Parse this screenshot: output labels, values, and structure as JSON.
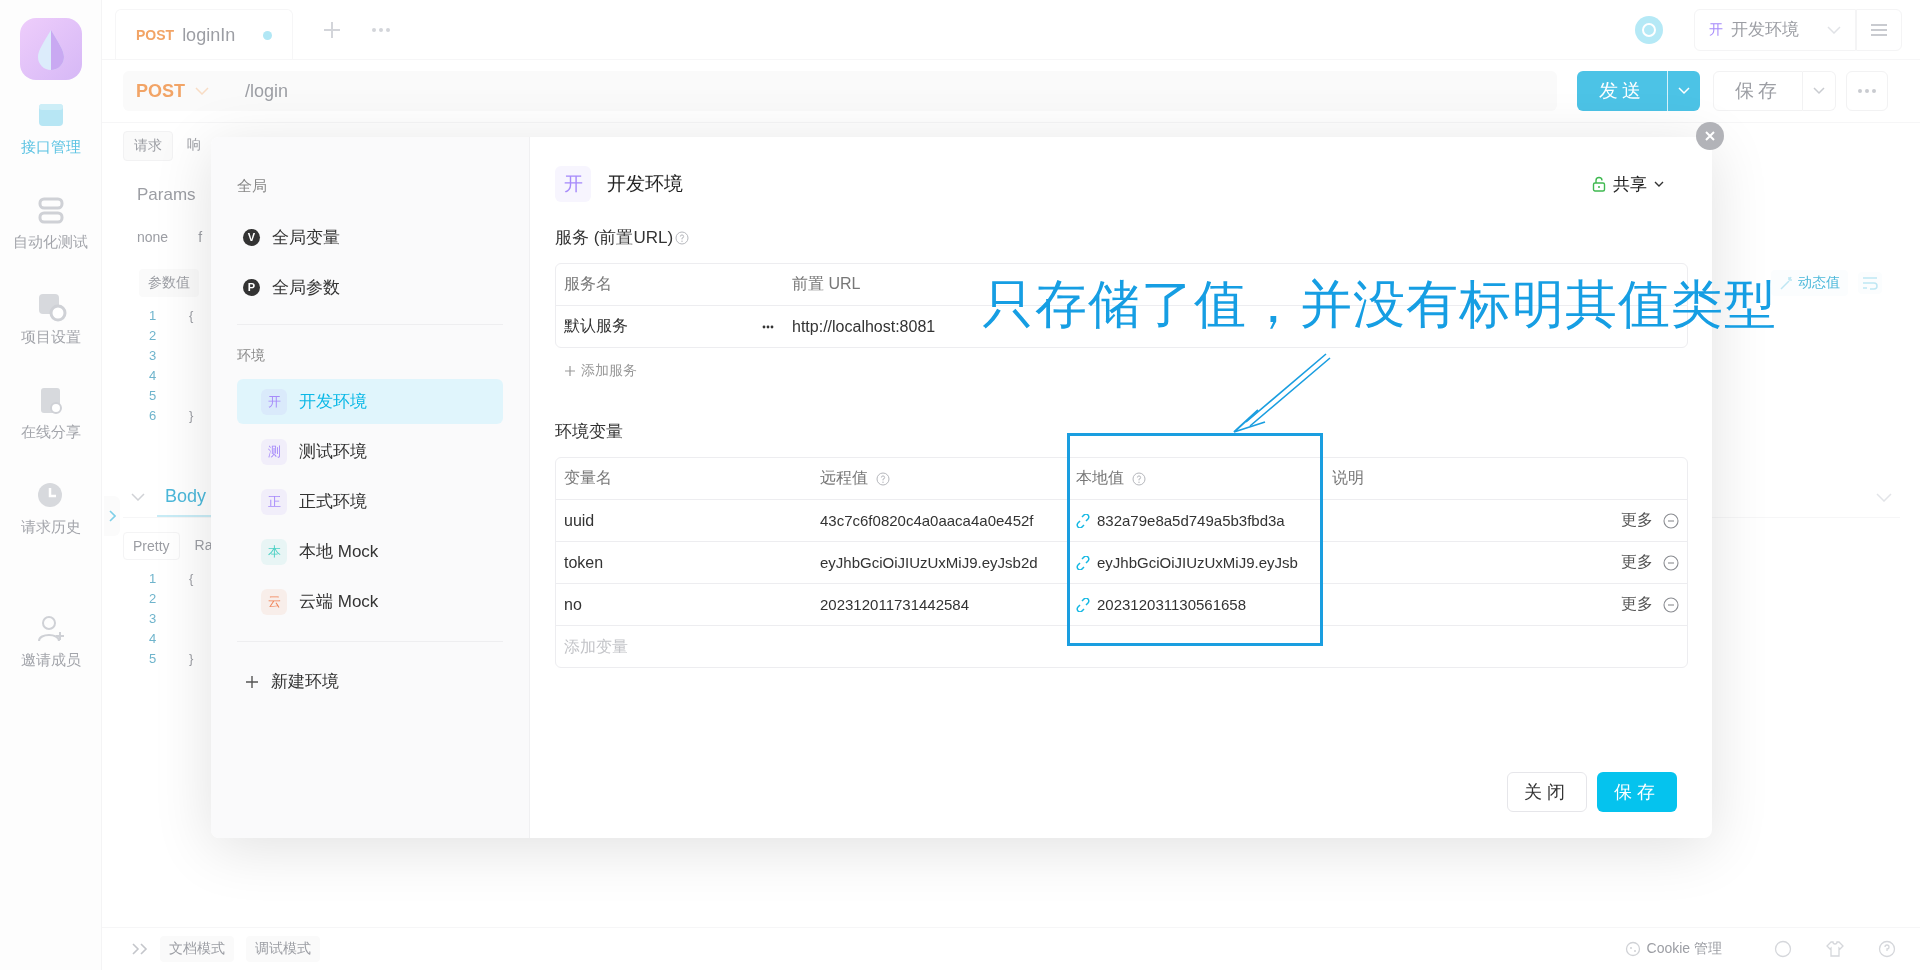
{
  "nav": {
    "items": [
      {
        "label": "接口管理",
        "selected": true
      },
      {
        "label": "自动化测试",
        "selected": false
      },
      {
        "label": "项目设置",
        "selected": false
      },
      {
        "label": "在线分享",
        "selected": false
      },
      {
        "label": "请求历史",
        "selected": false
      },
      {
        "label": "邀请成员",
        "selected": false
      }
    ]
  },
  "tabs": [
    {
      "method": "POST",
      "name": "loginIn",
      "unsaved": true
    }
  ],
  "env_selector": {
    "badge": "开",
    "label": "开发环境"
  },
  "request": {
    "method": "POST",
    "url": "/login",
    "send": "发送",
    "save": "保存"
  },
  "panel_tabs": [
    {
      "label": "请求",
      "selected": true
    },
    {
      "label": "响",
      "selected": false
    }
  ],
  "params_tab": "Params",
  "body_types": [
    "none",
    "f"
  ],
  "param_chip": "参数值",
  "request_code": [
    {
      "n": "1",
      "text": "{"
    },
    {
      "n": "2"
    },
    {
      "n": "3"
    },
    {
      "n": "4"
    },
    {
      "n": "5"
    },
    {
      "n": "6",
      "text": "}"
    }
  ],
  "dynamic_value": "动态值",
  "response": {
    "tab": "Body",
    "formats": [
      {
        "label": "Pretty",
        "selected": true
      },
      {
        "label": "Ra",
        "selected": false
      }
    ],
    "code": [
      {
        "n": "1",
        "text": "{"
      },
      {
        "n": "2"
      },
      {
        "n": "3"
      },
      {
        "n": "4"
      },
      {
        "n": "5",
        "text": "}"
      }
    ]
  },
  "bottom_bar": {
    "modes": [
      "文档模式",
      "调试模式"
    ],
    "cookie": "Cookie 管理"
  },
  "dialog": {
    "sidebar": {
      "global_heading": "全局",
      "global_items": [
        {
          "badge": "V",
          "label": "全局变量"
        },
        {
          "badge": "P",
          "label": "全局参数"
        }
      ],
      "env_heading": "环境",
      "environments": [
        {
          "badge": "开",
          "label": "开发环境",
          "color": "#a78bfa",
          "selected": true
        },
        {
          "badge": "测",
          "label": "测试环境",
          "color": "#a78bfa",
          "selected": false
        },
        {
          "badge": "正",
          "label": "正式环境",
          "color": "#a78bfa",
          "selected": false
        },
        {
          "badge": "本",
          "label": "本地 Mock",
          "color": "#4fd1c5",
          "selected": false
        },
        {
          "badge": "云",
          "label": "云端 Mock",
          "color": "#f0855a",
          "selected": false
        }
      ],
      "new_env": "新建环境"
    },
    "header": {
      "badge": "开",
      "title": "开发环境",
      "share": "共享"
    },
    "services": {
      "heading": "服务 (前置URL)",
      "columns": [
        "服务名",
        "前置 URL"
      ],
      "rows": [
        {
          "name": "默认服务",
          "prefix": "http://localhost:8081"
        }
      ],
      "add": "添加服务"
    },
    "variables": {
      "heading": "环境变量",
      "columns": [
        {
          "label": "变量名",
          "help": false
        },
        {
          "label": "远程值",
          "help": true
        },
        {
          "label": "本地值",
          "help": true
        },
        {
          "label": "说明",
          "help": false
        }
      ],
      "rows": [
        {
          "name": "uuid",
          "remote": "43c7c6f0820c4a0aaca4a0e452f",
          "local": "832a79e8a5d749a5b3fbd3a",
          "more": "更多"
        },
        {
          "name": "token",
          "remote": "eyJhbGciOiJIUzUxMiJ9.eyJsb2d",
          "local": "eyJhbGciOiJIUzUxMiJ9.eyJsb",
          "more": "更多"
        },
        {
          "name": "no",
          "remote": "202312011731442584",
          "local": "202312031130561658",
          "more": "更多"
        }
      ],
      "add_placeholder": "添加变量"
    },
    "buttons": [
      {
        "label": "关闭",
        "kind": "secondary"
      },
      {
        "label": "保存",
        "kind": "primary"
      }
    ]
  },
  "annotation": {
    "text": "只存储了值，并没有标明其值类型"
  }
}
